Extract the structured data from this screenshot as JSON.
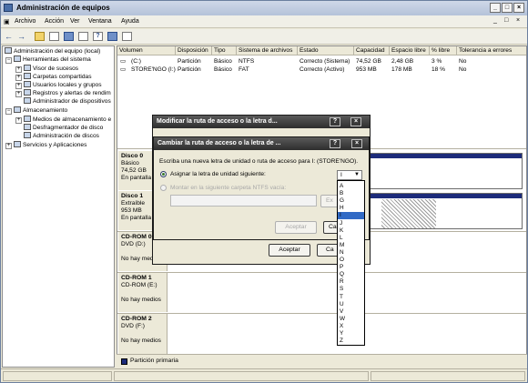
{
  "window": {
    "title": "Administración de equipos",
    "controls": [
      "_",
      "□",
      "×"
    ]
  },
  "menu": [
    "Archivo",
    "Acción",
    "Ver",
    "Ventana",
    "Ayuda"
  ],
  "inner_controls": [
    "_",
    "□",
    "×"
  ],
  "tree": {
    "root": "Administración del equipo (local)",
    "tools": "Herramientas del sistema",
    "tools_items": [
      "Visor de sucesos",
      "Carpetas compartidas",
      "Usuarios locales y grupos",
      "Registros y alertas de rendim",
      "Administrador de dispositivos"
    ],
    "storage": "Almacenamiento",
    "storage_items": [
      "Medios de almacenamiento e",
      "Desfragmentador de disco",
      "Administración de discos"
    ],
    "services": "Servicios y Aplicaciones"
  },
  "columns": [
    "Volumen",
    "Disposición",
    "Tipo",
    "Sistema de archivos",
    "Estado",
    "Capacidad",
    "Espacio libre",
    "% libre",
    "Tolerancia a errores"
  ],
  "volumes": [
    {
      "name": "(C:)",
      "layout": "Partición",
      "type": "Básico",
      "fs": "NTFS",
      "status": "Correcto (Sistema)",
      "capacity": "74,52 GB",
      "free": "2,48 GB",
      "pct": "3 %",
      "fault": "No"
    },
    {
      "name": "STORE'NGO (I:)",
      "layout": "Partición",
      "type": "Básico",
      "fs": "FAT",
      "status": "Correcto (Activo)",
      "capacity": "953 MB",
      "free": "178 MB",
      "pct": "18 %",
      "fault": "No"
    }
  ],
  "disks": [
    {
      "title": "Disco 0",
      "l1": "Básico",
      "l2": "74,52 GB",
      "l3": "En pantalla"
    },
    {
      "title": "Disco 1",
      "l1": "Extraíble",
      "l2": "953 MB",
      "l3": "En pantalla"
    },
    {
      "title": "CD-ROM 0",
      "l1": "DVD (D:)",
      "l2": "",
      "l3": "No hay medios"
    },
    {
      "title": "CD-ROM 1",
      "l1": "CD-ROM (E:)",
      "l2": "",
      "l3": "No hay medios"
    },
    {
      "title": "CD-ROM 2",
      "l1": "DVD (F:)",
      "l2": "",
      "l3": "No hay medios"
    }
  ],
  "legend": "Partición primaria",
  "dialog_back": {
    "title": "Modificar la ruta de acceso o la letra d...",
    "accept": "Aceptar",
    "cancel_partial": "Ca"
  },
  "dialog_front": {
    "title": "Cambiar la ruta de acceso o la letra de ...",
    "prompt": "Escriba una nueva letra de unidad o ruta de acceso para I: (STORE'NGO).",
    "assign_label": "Asignar la letra de unidad siguiente:",
    "mount_label": "Montar en la siguiente carpeta NTFS vacía:",
    "browse_partial": "Ex",
    "accept": "Aceptar",
    "cancel_partial": "Ca",
    "selected_letter": "I",
    "letters": [
      "A",
      "B",
      "G",
      "H",
      "I",
      "J",
      "K",
      "L",
      "M",
      "N",
      "O",
      "P",
      "Q",
      "R",
      "S",
      "T",
      "U",
      "V",
      "W",
      "X",
      "Y",
      "Z"
    ],
    "help": "?",
    "close": "×"
  }
}
